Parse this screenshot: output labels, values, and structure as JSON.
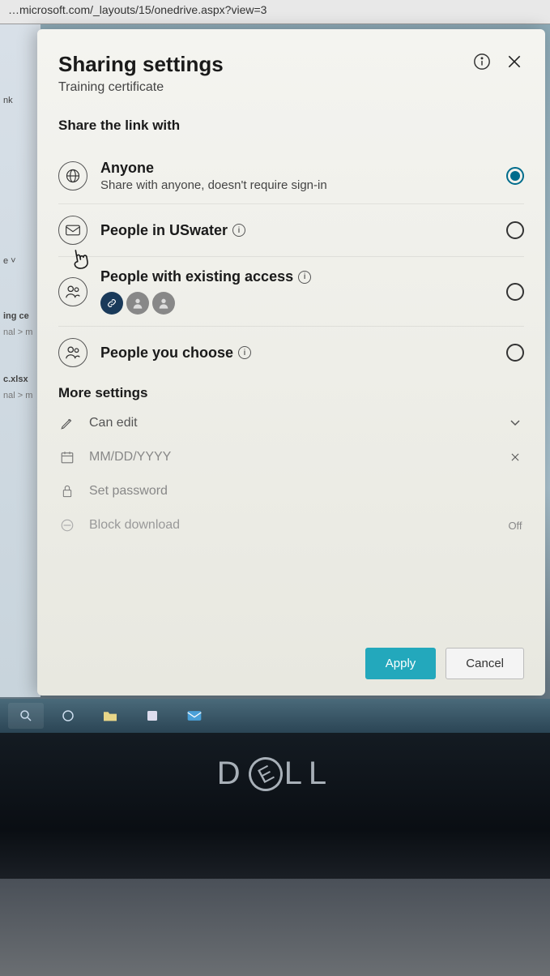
{
  "url": "…microsoft.com/_layouts/15/onedrive.aspx?view=3",
  "background": {
    "nav_item": "nk",
    "dropdown": "e",
    "file1_title": "ing ce",
    "file1_path": "nal > m",
    "file2_title": "c.xlsx",
    "file2_path": "nal > m"
  },
  "dialog": {
    "title": "Sharing settings",
    "subtitle": "Training certificate",
    "section_label": "Share the link with",
    "options": {
      "anyone": {
        "title": "Anyone",
        "sub": "Share with anyone, doesn't require sign-in",
        "selected": true
      },
      "org": {
        "title": "People in USwater",
        "selected": false
      },
      "existing": {
        "title": "People with existing access",
        "selected": false
      },
      "choose": {
        "title": "People you choose",
        "selected": false
      }
    },
    "more_settings": {
      "label": "More settings",
      "permission": "Can edit",
      "date_placeholder": "MM/DD/YYYY",
      "password": "Set password",
      "block_download": "Block download",
      "block_download_state": "Off"
    },
    "buttons": {
      "apply": "Apply",
      "cancel": "Cancel"
    }
  },
  "hardware": {
    "brand": "DELL"
  }
}
